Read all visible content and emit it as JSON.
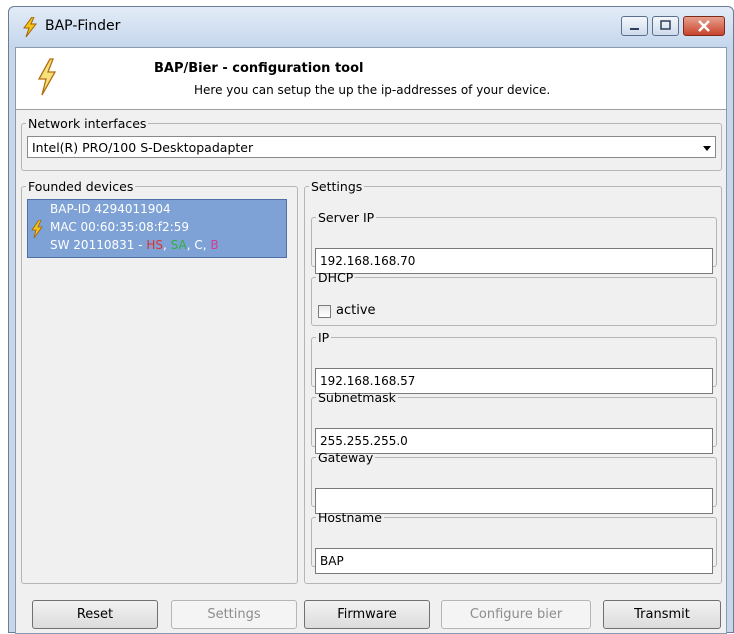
{
  "window": {
    "title": "BAP-Finder",
    "app_icon": "lightning-icon"
  },
  "header": {
    "title": "BAP/Bier - configuration tool",
    "subtitle": "Here you can setup the up the ip-addresses of your device."
  },
  "network_interfaces": {
    "legend": "Network interfaces",
    "selected": "Intel(R) PRO/100 S-Desktopadapter"
  },
  "devices": {
    "legend": "Founded devices",
    "items": [
      {
        "id_line": "BAP-ID 4294011904",
        "mac_line": "MAC 00:60:35:08:f2:59",
        "sw_line": "SW 20110831 - ",
        "flags": [
          {
            "text": "HS",
            "color": "#e03030"
          },
          {
            "sep": ", "
          },
          {
            "text": "SA",
            "color": "#30b040"
          },
          {
            "sep": ", "
          },
          {
            "text": "C",
            "color": "#ffffff"
          },
          {
            "sep": ", "
          },
          {
            "text": "B",
            "color": "#d04090"
          }
        ]
      }
    ]
  },
  "settings": {
    "legend": "Settings",
    "server_ip": {
      "label": "Server IP",
      "value": "192.168.168.70"
    },
    "dhcp": {
      "label": "DHCP",
      "checkbox_label": "active",
      "checked": false
    },
    "ip": {
      "label": "IP",
      "value": "192.168.168.57"
    },
    "subnetmask": {
      "label": "Subnetmask",
      "value": "255.255.255.0"
    },
    "gateway": {
      "label": "Gateway",
      "value": ""
    },
    "hostname": {
      "label": "Hostname",
      "value": "BAP"
    }
  },
  "buttons": {
    "reset": "Reset",
    "settings": "Settings",
    "firmware": "Firmware",
    "configure_bier": "Configure bier",
    "transmit": "Transmit"
  }
}
